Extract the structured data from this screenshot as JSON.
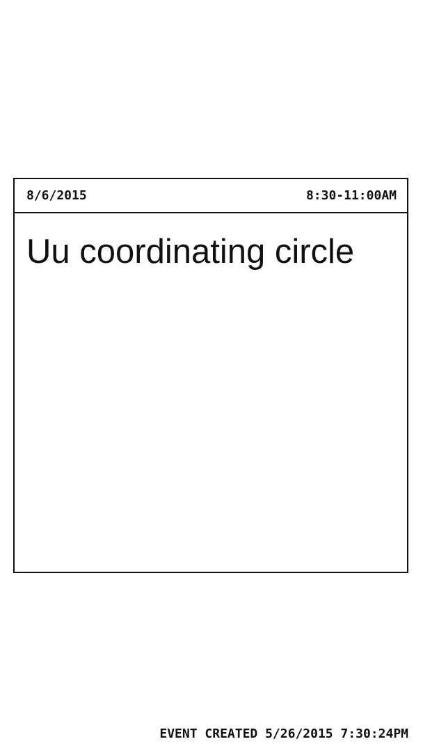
{
  "event": {
    "date": "8/6/2015",
    "time": "8:30-11:00AM",
    "title": "Uu coordinating circle"
  },
  "footer": {
    "created_label": "EVENT CREATED 5/26/2015 7:30:24PM"
  }
}
